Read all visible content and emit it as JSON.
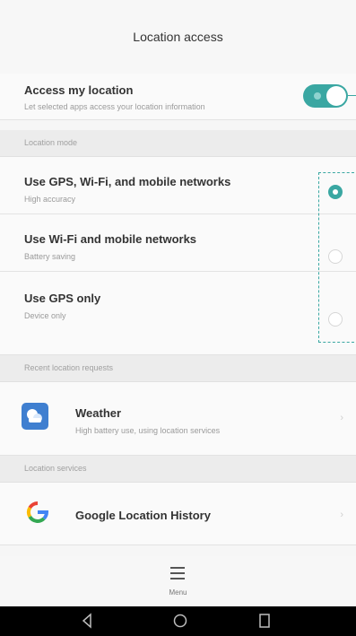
{
  "header": {
    "title": "Location access"
  },
  "access": {
    "label": "Access my location",
    "subtitle": "Let selected apps access your location information",
    "enabled": true
  },
  "location_mode": {
    "header": "Location mode",
    "options": [
      {
        "label": "Use GPS, Wi-Fi, and mobile networks",
        "subtitle": "High accuracy",
        "selected": true
      },
      {
        "label": "Use Wi-Fi and mobile networks",
        "subtitle": "Battery saving",
        "selected": false
      },
      {
        "label": "Use GPS only",
        "subtitle": "Device only",
        "selected": false
      }
    ]
  },
  "recent": {
    "header": "Recent location requests",
    "items": [
      {
        "app": "Weather",
        "detail": "High battery use, using location services",
        "icon": "weather-app-icon"
      }
    ]
  },
  "services": {
    "header": "Location services",
    "items": [
      {
        "label": "Google Location History",
        "icon": "google-g-icon"
      }
    ]
  },
  "footer": {
    "menu_label": "Menu"
  },
  "colors": {
    "accent": "#3aa7a2",
    "weather_icon": "#3f7fd0",
    "nav_bar": "#000000"
  }
}
